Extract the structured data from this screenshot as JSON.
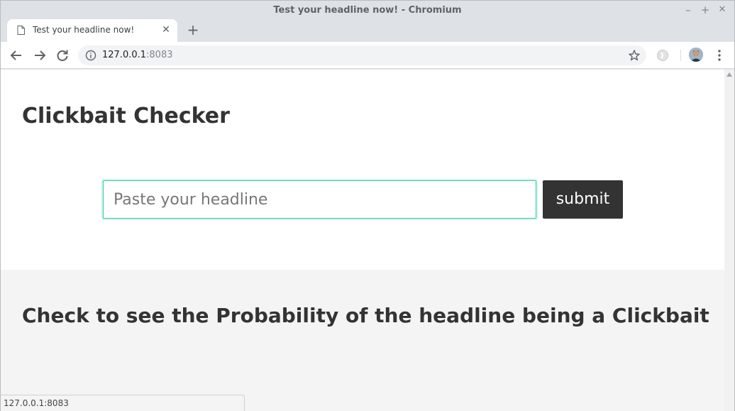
{
  "window": {
    "title": "Test your headline now! - Chromium",
    "controls": [
      "–",
      "+",
      "✕"
    ]
  },
  "tab": {
    "title": "Test your headline now!",
    "close": "✕",
    "new_tab": "+"
  },
  "address_bar": {
    "host": "127.0.0.1",
    "port": ":8083"
  },
  "page": {
    "heading": "Clickbait Checker",
    "input_placeholder": "Paste your headline",
    "input_value": "",
    "submit_label": "submit",
    "result_heading": "Check to see the Probability of the headline being a Clickbait"
  },
  "status_bar": {
    "url": "127.0.0.1:8083"
  },
  "colors": {
    "accent": "#3cc9a8",
    "button_bg": "#333333",
    "section_bg": "#f4f4f4"
  }
}
